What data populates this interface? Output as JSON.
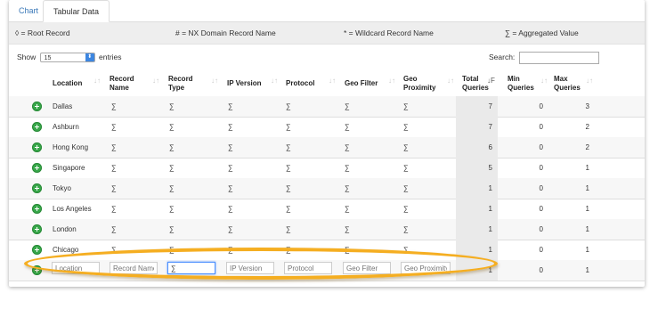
{
  "tabs": [
    {
      "label": "Chart"
    },
    {
      "label": "Tabular Data"
    }
  ],
  "legend": {
    "root": "◊ = Root Record",
    "nx": "# = NX Domain Record Name",
    "wildcard": "* = Wildcard Record Name",
    "aggregated": "∑ = Aggregated Value"
  },
  "controls": {
    "show_label": "Show",
    "entries_value": "15",
    "entries_label": "entries",
    "search_label": "Search:",
    "search_value": ""
  },
  "columns": [
    {
      "label": "Location"
    },
    {
      "label": "Record Name"
    },
    {
      "label": "Record Type"
    },
    {
      "label": "IP Version"
    },
    {
      "label": "Protocol"
    },
    {
      "label": "Geo Filter"
    },
    {
      "label": "Geo Proximity"
    },
    {
      "label": "Total Queries"
    },
    {
      "label": "Min Queries"
    },
    {
      "label": "Max Queries"
    }
  ],
  "rows": [
    {
      "location": "Dallas",
      "record_name": "∑",
      "record_type": "∑",
      "ip_version": "∑",
      "protocol": "∑",
      "geo_filter": "∑",
      "geo_proximity": "∑",
      "total": "7",
      "min": "0",
      "max": "3"
    },
    {
      "location": "Ashburn",
      "record_name": "∑",
      "record_type": "∑",
      "ip_version": "∑",
      "protocol": "∑",
      "geo_filter": "∑",
      "geo_proximity": "∑",
      "total": "7",
      "min": "0",
      "max": "2"
    },
    {
      "location": "Hong Kong",
      "record_name": "∑",
      "record_type": "∑",
      "ip_version": "∑",
      "protocol": "∑",
      "geo_filter": "∑",
      "geo_proximity": "∑",
      "total": "6",
      "min": "0",
      "max": "2"
    },
    {
      "location": "Singapore",
      "record_name": "∑",
      "record_type": "∑",
      "ip_version": "∑",
      "protocol": "∑",
      "geo_filter": "∑",
      "geo_proximity": "∑",
      "total": "5",
      "min": "0",
      "max": "1"
    },
    {
      "location": "Tokyo",
      "record_name": "∑",
      "record_type": "∑",
      "ip_version": "∑",
      "protocol": "∑",
      "geo_filter": "∑",
      "geo_proximity": "∑",
      "total": "1",
      "min": "0",
      "max": "1"
    },
    {
      "location": "Los Angeles",
      "record_name": "∑",
      "record_type": "∑",
      "ip_version": "∑",
      "protocol": "∑",
      "geo_filter": "∑",
      "geo_proximity": "∑",
      "total": "1",
      "min": "0",
      "max": "1"
    },
    {
      "location": "London",
      "record_name": "∑",
      "record_type": "∑",
      "ip_version": "∑",
      "protocol": "∑",
      "geo_filter": "∑",
      "geo_proximity": "∑",
      "total": "1",
      "min": "0",
      "max": "1"
    },
    {
      "location": "Chicago",
      "record_name": "∑",
      "record_type": "∑",
      "ip_version": "∑",
      "protocol": "∑",
      "geo_filter": "∑",
      "geo_proximity": "∑",
      "total": "1",
      "min": "0",
      "max": "1"
    },
    {
      "location": "Amsterdam",
      "record_name": "∑",
      "record_type": "∑",
      "ip_version": "∑",
      "protocol": "∑",
      "geo_filter": "∑",
      "geo_proximity": "∑",
      "total": "1",
      "min": "0",
      "max": "1"
    }
  ],
  "filters": [
    {
      "placeholder": "Location",
      "value": ""
    },
    {
      "placeholder": "Record Name",
      "value": ""
    },
    {
      "placeholder": "",
      "value": "∑"
    },
    {
      "placeholder": "IP Version",
      "value": ""
    },
    {
      "placeholder": "Protocol",
      "value": ""
    },
    {
      "placeholder": "Geo Filter",
      "value": ""
    },
    {
      "placeholder": "Geo Proximity",
      "value": ""
    }
  ],
  "colors": {
    "accent": "#3a78b8",
    "expand_button": "#38a84a",
    "highlight_ring": "#f5ae21",
    "sorted_column_bg": "#eaeaea"
  },
  "icons": {
    "expand": "plus-circle-icon",
    "sort": "sort-arrows-icon",
    "dropdown": "chevron-updown-icon"
  }
}
